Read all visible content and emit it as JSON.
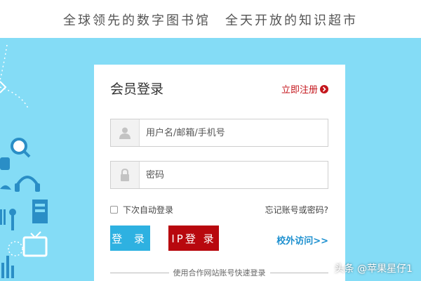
{
  "banner": {
    "slogan": "全球领先的数字图书馆　全天开放的知识超市"
  },
  "login": {
    "title": "会员登录",
    "register_label": "立即注册",
    "username_placeholder": "用户名/邮箱/手机号",
    "password_placeholder": "密码",
    "remember_label": "下次自动登录",
    "forgot_label": "忘记账号或密码?",
    "login_label": "登 录",
    "ip_login_label": "IP登 录",
    "campus_label": "校外访问>>",
    "partner_label": "使用合作网站账号快速登录"
  },
  "watermark": "头条 @苹果星仔1",
  "colors": {
    "hero_bg": "#84dcf6",
    "accent_red": "#c4161c",
    "accent_blue": "#2eb1e1",
    "ip_red": "#b8080e",
    "link_blue": "#1b8fcf"
  },
  "icons": [
    "user-icon",
    "lock-icon",
    "arrow-right-icon",
    "search-icon",
    "headphones-icon",
    "cup-icon",
    "tv-icon",
    "bar-chart-icon"
  ]
}
